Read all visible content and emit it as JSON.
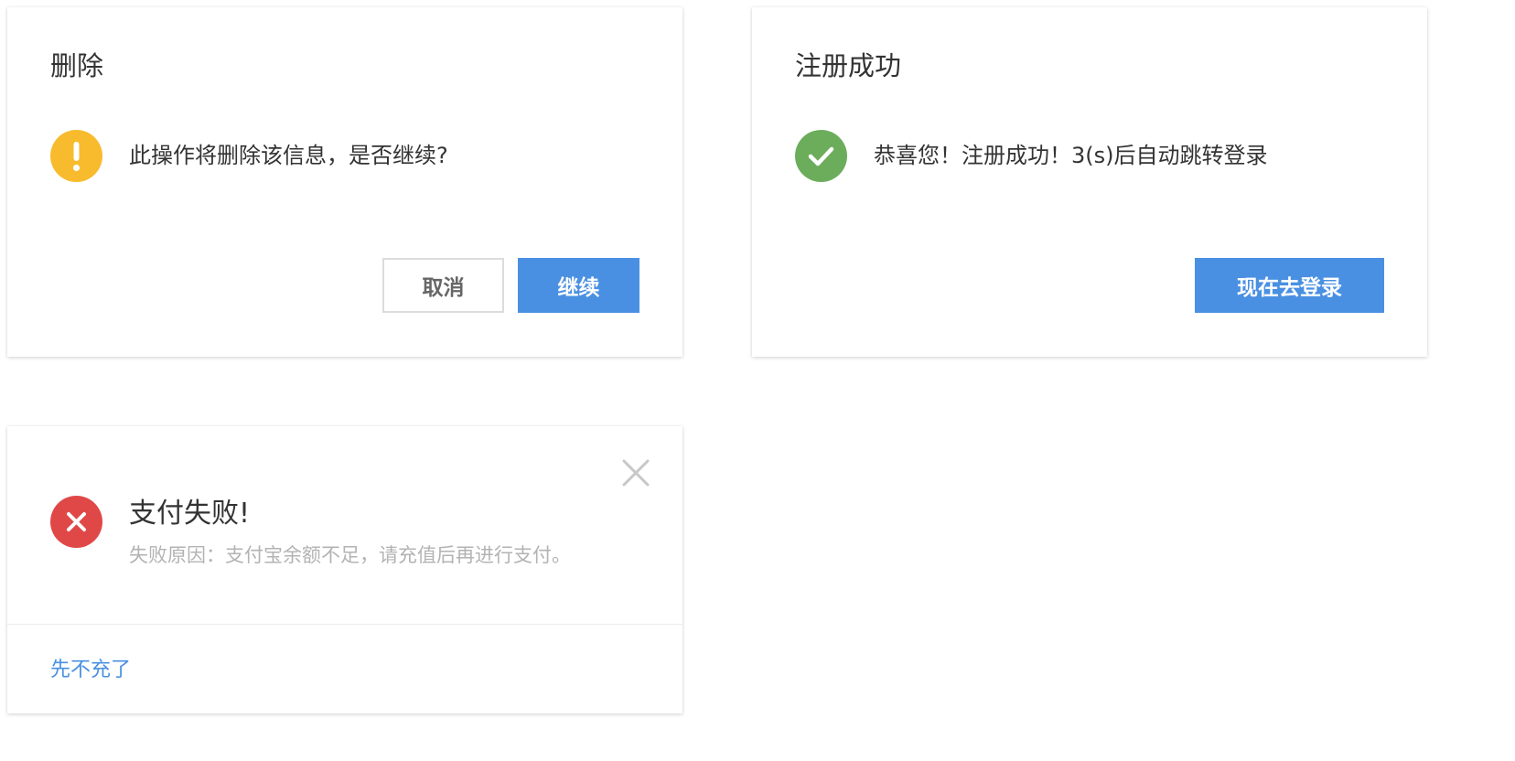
{
  "delete_dialog": {
    "title": "删除",
    "icon": "exclamation-icon",
    "icon_color": "#f8bb2d",
    "message": "此操作将删除该信息，是否继续?",
    "cancel_label": "取消",
    "confirm_label": "继续",
    "confirm_color": "#4a90e2"
  },
  "success_dialog": {
    "title": "注册成功",
    "icon": "checkmark-icon",
    "icon_color": "#6cad5c",
    "message": "恭喜您！注册成功！3(s)后自动跳转登录",
    "login_label": "现在去登录",
    "login_color": "#4a90e2"
  },
  "fail_dialog": {
    "icon": "cross-icon",
    "icon_color": "#e04848",
    "title": "支付失败!",
    "description": "失败原因：支付宝余额不足，请充值后再进行支付。",
    "close_icon": "close-icon",
    "footer_link": "先不充了",
    "link_color": "#4a90e2"
  }
}
